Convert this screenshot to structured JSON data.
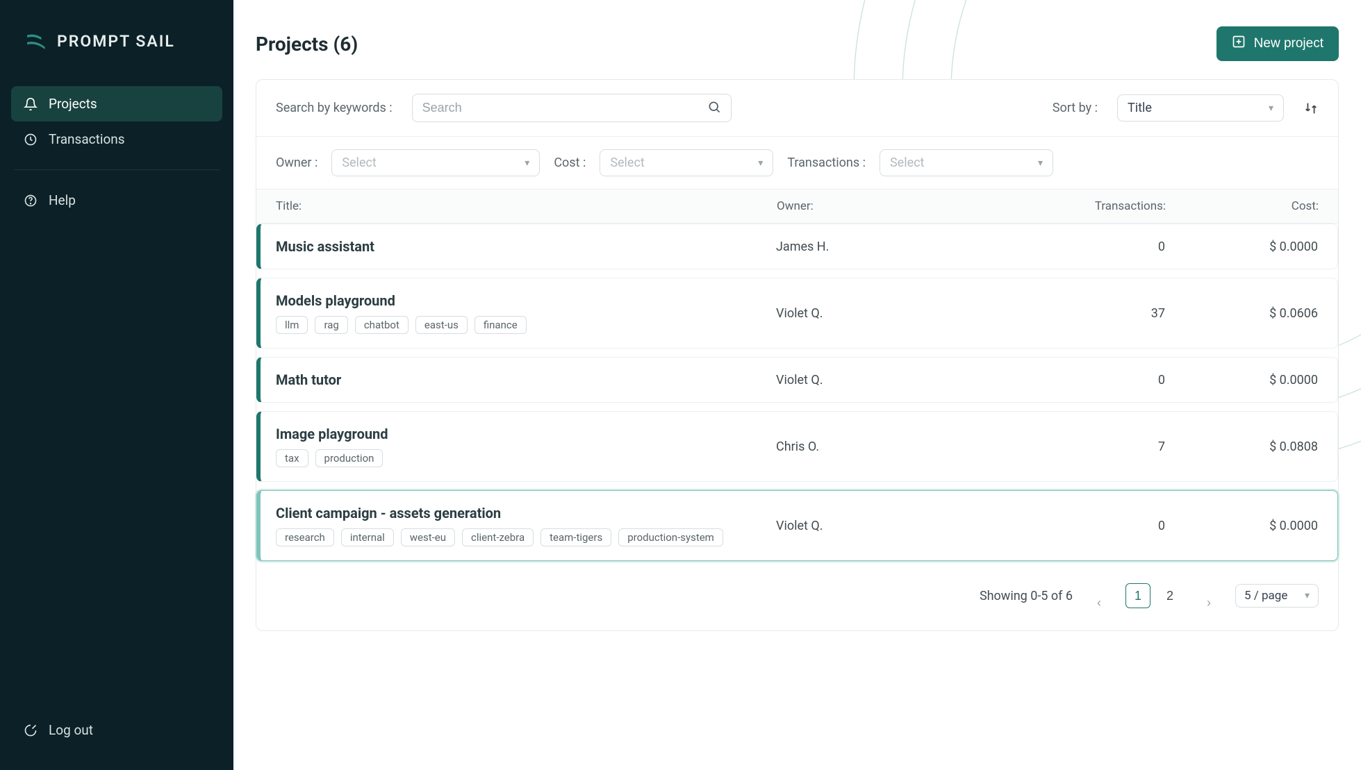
{
  "brand": {
    "name": "PROMPT SAIL"
  },
  "sidebar": {
    "items": [
      {
        "label": "Projects",
        "icon": "bell-icon",
        "active": true
      },
      {
        "label": "Transactions",
        "icon": "clock-icon",
        "active": false
      }
    ],
    "help": {
      "label": "Help"
    },
    "logout": {
      "label": "Log out"
    }
  },
  "header": {
    "title": "Projects (6)",
    "new_project_label": "New project"
  },
  "toolbar": {
    "search_label": "Search by keywords :",
    "search_placeholder": "Search",
    "sort_label": "Sort by :",
    "sort_value": "Title"
  },
  "filters": {
    "owner_label": "Owner :",
    "owner_placeholder": "Select",
    "cost_label": "Cost :",
    "cost_placeholder": "Select",
    "transactions_label": "Transactions :",
    "transactions_placeholder": "Select"
  },
  "columns": {
    "title": "Title:",
    "owner": "Owner:",
    "transactions": "Transactions:",
    "cost": "Cost:"
  },
  "projects": [
    {
      "title": "Music assistant",
      "owner": "James H.",
      "transactions": "0",
      "cost": "$ 0.0000",
      "tags": [],
      "highlight": false
    },
    {
      "title": "Models playground",
      "owner": "Violet Q.",
      "transactions": "37",
      "cost": "$ 0.0606",
      "tags": [
        "llm",
        "rag",
        "chatbot",
        "east-us",
        "finance"
      ],
      "highlight": false
    },
    {
      "title": "Math tutor",
      "owner": "Violet Q.",
      "transactions": "0",
      "cost": "$ 0.0000",
      "tags": [],
      "highlight": false
    },
    {
      "title": "Image playground",
      "owner": "Chris O.",
      "transactions": "7",
      "cost": "$ 0.0808",
      "tags": [
        "tax",
        "production"
      ],
      "highlight": false
    },
    {
      "title": "Client campaign - assets generation",
      "owner": "Violet Q.",
      "transactions": "0",
      "cost": "$ 0.0000",
      "tags": [
        "research",
        "internal",
        "west-eu",
        "client-zebra",
        "team-tigers",
        "production-system"
      ],
      "highlight": true
    }
  ],
  "pagination": {
    "info": "Showing 0-5 of 6",
    "pages": [
      "1",
      "2"
    ],
    "active_page": "1",
    "page_size": "5 / page"
  }
}
